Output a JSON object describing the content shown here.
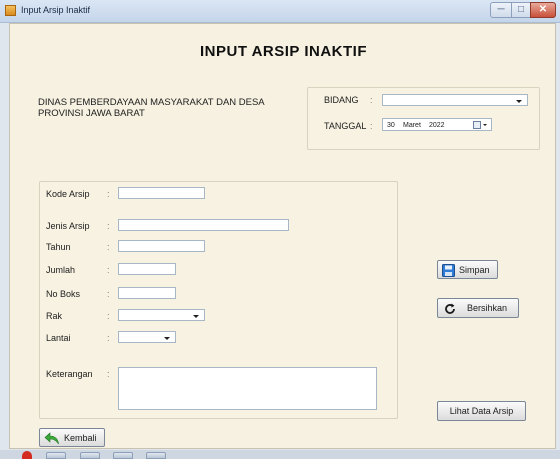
{
  "window": {
    "title": "Input Arsip Inaktif",
    "min_label": "─",
    "max_label": "□",
    "close_label": "✕"
  },
  "header": {
    "title": "INPUT ARSIP INAKTIF",
    "org_line1": "DINAS PEMBERDAYAAN MASYARAKAT DAN DESA",
    "org_line2": "PROVINSI JAWA BARAT"
  },
  "top_panel": {
    "bidang_label": "BIDANG",
    "bidang_value": "",
    "tanggal_label": "TANGGAL",
    "date_day": "30",
    "date_month": "Maret",
    "date_year": "2022",
    "colon": ":"
  },
  "form": {
    "colon": ":",
    "kode_label": "Kode Arsip",
    "kode_value": "",
    "jenis_label": "Jenis Arsip",
    "jenis_value": "",
    "tahun_label": "Tahun",
    "tahun_value": "",
    "jumlah_label": "Jumlah",
    "jumlah_value": "",
    "noboks_label": "No Boks",
    "noboks_value": "",
    "rak_label": "Rak",
    "rak_value": "",
    "lantai_label": "Lantai",
    "lantai_value": "",
    "keterangan_label": "Keterangan",
    "keterangan_value": ""
  },
  "buttons": {
    "simpan": "Simpan",
    "bersihkan": "Bersihkan",
    "lihat": "Lihat Data Arsip",
    "kembali": "Kembali"
  },
  "colors": {
    "background": "#f6f1e0",
    "accent": "#2f7bd6"
  }
}
